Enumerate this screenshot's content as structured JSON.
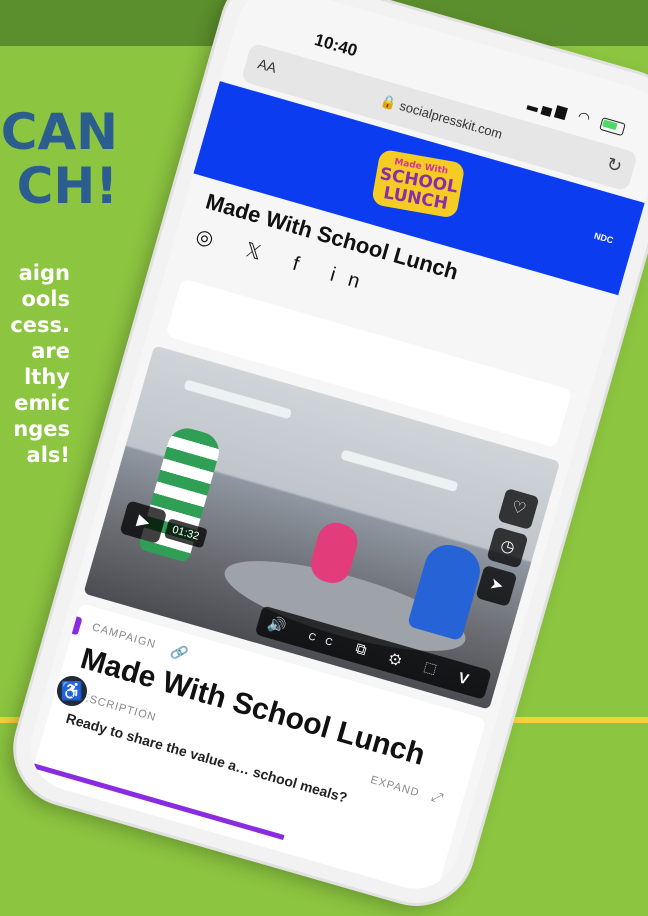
{
  "hero": {
    "headline_line1": "CAN",
    "headline_line2": "CH!",
    "blurb_lines": [
      "aign",
      "ools",
      "cess.",
      "are",
      "lthy",
      "emic",
      "nges",
      "als!"
    ]
  },
  "status_bar": {
    "time": "10:40",
    "signal": "▂▄▆",
    "wifi": "wifi-icon"
  },
  "browser": {
    "text_size_label": "AA",
    "lock": "🔒",
    "url": "socialpresskit.com",
    "reload": "↻"
  },
  "site_header": {
    "logo_line1": "Made With",
    "logo_line2": "SCHOOL",
    "logo_line3": "LUNCH",
    "partners": "NDC"
  },
  "page": {
    "title": "Made With School Lunch",
    "social_icons": [
      "instagram-icon",
      "x-icon",
      "facebook-icon",
      "linkedin-icon"
    ],
    "social_glyphs": [
      "◎",
      "𝕏",
      "f",
      "in"
    ]
  },
  "video": {
    "duration": "01:32",
    "play": "▶",
    "side_controls": [
      "♡",
      "◷",
      "➤"
    ],
    "bottom_controls": [
      "🔊",
      "CC",
      "⧉",
      "⚙",
      "⬚",
      "V"
    ]
  },
  "campaign": {
    "label": "CAMPAIGN",
    "link": "🔗",
    "title": "Made With School Lunch",
    "description_label": "DESCRIPTION",
    "expand_label": "EXPAND",
    "expand_glyph": "⤢",
    "description_text": "Ready to share the value a… school meals?"
  },
  "accessibility": {
    "glyph": "♿"
  },
  "colors": {
    "background_green": "#8cc540",
    "top_bar_green": "#5b8e2c",
    "headline_blue": "#2b5e8e",
    "site_blue": "#0b3cf0",
    "accent_purple": "#8a2be2",
    "bottom_yellow": "#f3d23a"
  }
}
